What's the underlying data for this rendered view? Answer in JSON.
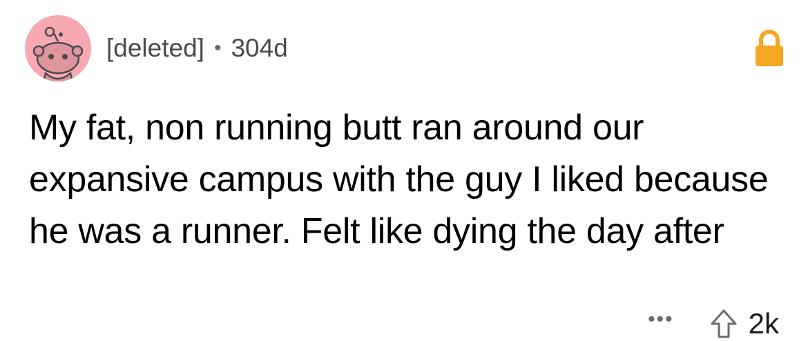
{
  "comment": {
    "author": "[deleted]",
    "separator": "•",
    "age": "304d",
    "avatar_icon": "snoo-avatar-icon",
    "avatar_bg": "#f7a8b0",
    "locked_icon": "lock-icon",
    "lock_color": "#f5a623",
    "text": "My fat, non running butt ran around our expansive campus with the guy I liked because he was a runner. Felt like dying the day after"
  },
  "actions": {
    "more_label": "•••",
    "upvote_icon": "upvote-arrow-icon",
    "score": "2k"
  }
}
